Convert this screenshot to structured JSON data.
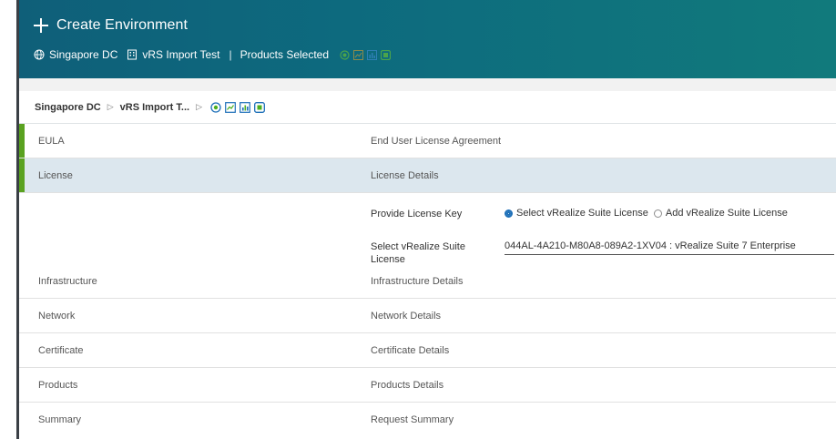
{
  "header": {
    "title": "Create Environment",
    "datacenter": "Singapore DC",
    "environment": "vRS Import Test",
    "separator": "|",
    "products_label": "Products Selected"
  },
  "breadcrumb": {
    "datacenter": "Singapore DC",
    "environment": "vRS Import T...",
    "sep": "▷"
  },
  "steps": [
    {
      "name": "EULA",
      "desc": "End User License Agreement"
    },
    {
      "name": "License",
      "desc": "License Details"
    },
    {
      "name": "Infrastructure",
      "desc": "Infrastructure Details"
    },
    {
      "name": "Network",
      "desc": "Network Details"
    },
    {
      "name": "Certificate",
      "desc": "Certificate Details"
    },
    {
      "name": "Products",
      "desc": "Products Details"
    },
    {
      "name": "Summary",
      "desc": "Request Summary"
    }
  ],
  "license": {
    "key_label": "Provide License Key",
    "option_select": "Select vRealize Suite License",
    "option_add": "Add vRealize Suite License",
    "select_label": "Select vRealize Suite License",
    "select_value": "044AL-4A210-M80A8-089A2-1XV04 : vRealize Suite 7 Enterprise"
  },
  "colors": {
    "header_start": "#0f5f79",
    "header_end": "#117a7c",
    "active_bar": "#5aa220",
    "active_row": "#dce7ee",
    "radio_selected": "#1d6fb8"
  },
  "icons": [
    "plus-icon",
    "globe-icon",
    "building-icon",
    "product-circle-icon",
    "product-chart-icon",
    "product-bar-icon",
    "product-square-icon"
  ]
}
